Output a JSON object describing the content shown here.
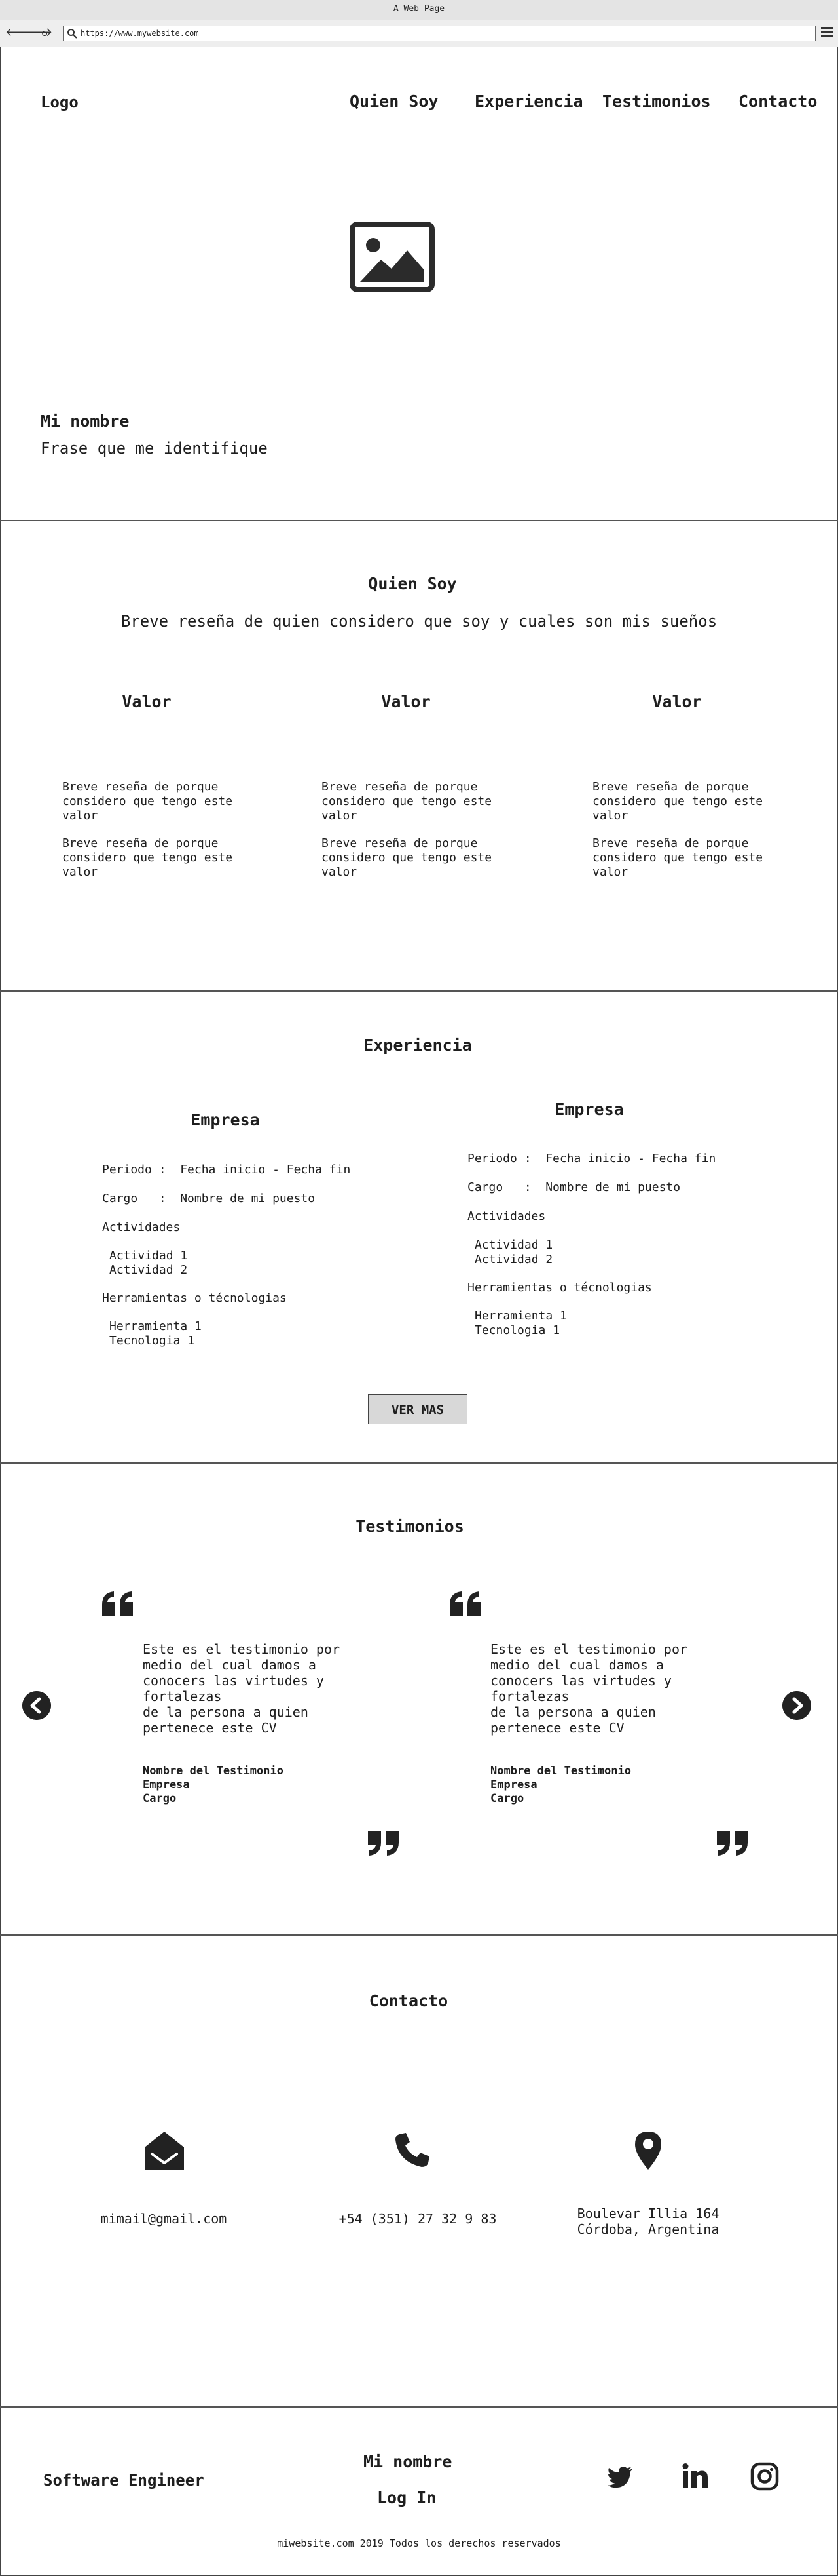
{
  "browser": {
    "title": "A Web Page",
    "url": "https://www.mywebsite.com"
  },
  "header": {
    "logo": "Logo",
    "nav": [
      "Quien Soy",
      "Experiencia",
      "Testimonios",
      "Contacto"
    ]
  },
  "hero": {
    "name": "Mi nombre",
    "phrase": "Frase que me identifique"
  },
  "about": {
    "title": "Quien Soy",
    "subtitle": "Breve reseña de quien considero que soy y cuales son mis sueños",
    "values": [
      {
        "title": "Valor",
        "texts": [
          "Breve reseña de porque considero que tengo este valor",
          "Breve reseña de porque considero que tengo este valor"
        ]
      },
      {
        "title": "Valor",
        "texts": [
          "Breve reseña de porque considero que tengo este valor",
          "Breve reseña de porque considero que tengo este valor"
        ]
      },
      {
        "title": "Valor",
        "texts": [
          "Breve reseña de porque considero que tengo este valor",
          "Breve reseña de porque considero que tengo este valor"
        ]
      }
    ]
  },
  "experience": {
    "title": "Experiencia",
    "companies": [
      {
        "name": "Empresa",
        "period": "Periodo :  Fecha inicio - Fecha fin",
        "role": "Cargo   :  Nombre de mi puesto",
        "activities_label": "Actividades",
        "activities": [
          "Actividad 1",
          "Actividad 2"
        ],
        "tools_label": "Herramientas o técnologias",
        "tools": [
          "Herramienta 1",
          "Tecnologia 1"
        ]
      },
      {
        "name": "Empresa",
        "period": "Periodo :  Fecha inicio - Fecha fin",
        "role": "Cargo   :  Nombre de mi puesto",
        "activities_label": "Actividades",
        "activities": [
          "Actividad 1",
          "Actividad 2"
        ],
        "tools_label": "Herramientas o técnologias",
        "tools": [
          "Herramienta 1",
          "Tecnologia 1"
        ]
      }
    ],
    "more_button": "VER MAS"
  },
  "testimonials": {
    "title": "Testimonios",
    "items": [
      {
        "text": [
          "Este es el testimonio por",
          "medio del cual damos a",
          "conocers las virtudes y",
          "fortalezas",
          "de la persona a quien",
          "pertenece este CV"
        ],
        "name": "Nombre del Testimonio",
        "company": "Empresa",
        "role": "Cargo"
      },
      {
        "text": [
          "Este es el testimonio por",
          "medio del cual damos a",
          "conocers las virtudes y",
          "fortalezas",
          "de la persona a quien",
          "pertenece este CV"
        ],
        "name": "Nombre del Testimonio",
        "company": "Empresa",
        "role": "Cargo"
      }
    ],
    "icons": {
      "prev": "chevron-left-icon",
      "next": "chevron-right-icon",
      "open_quote": "quote-open-icon",
      "close_quote": "quote-close-icon"
    }
  },
  "contact": {
    "title": "Contacto",
    "email": "mimail@gmail.com",
    "phone": "+54 (351) 27 32 9 83",
    "address_line1": "Boulevar Illia 164",
    "address_line2": "Córdoba, Argentina",
    "icons": [
      "envelope-open-icon",
      "phone-icon",
      "map-pin-icon"
    ]
  },
  "footer": {
    "role": "Software Engineer",
    "name_link": "Mi nombre",
    "login_link": "Log In",
    "social_icons": [
      "twitter-icon",
      "linkedin-icon",
      "instagram-icon"
    ],
    "copyright": "miwebsite.com 2019 Todos los derechos reservados"
  }
}
